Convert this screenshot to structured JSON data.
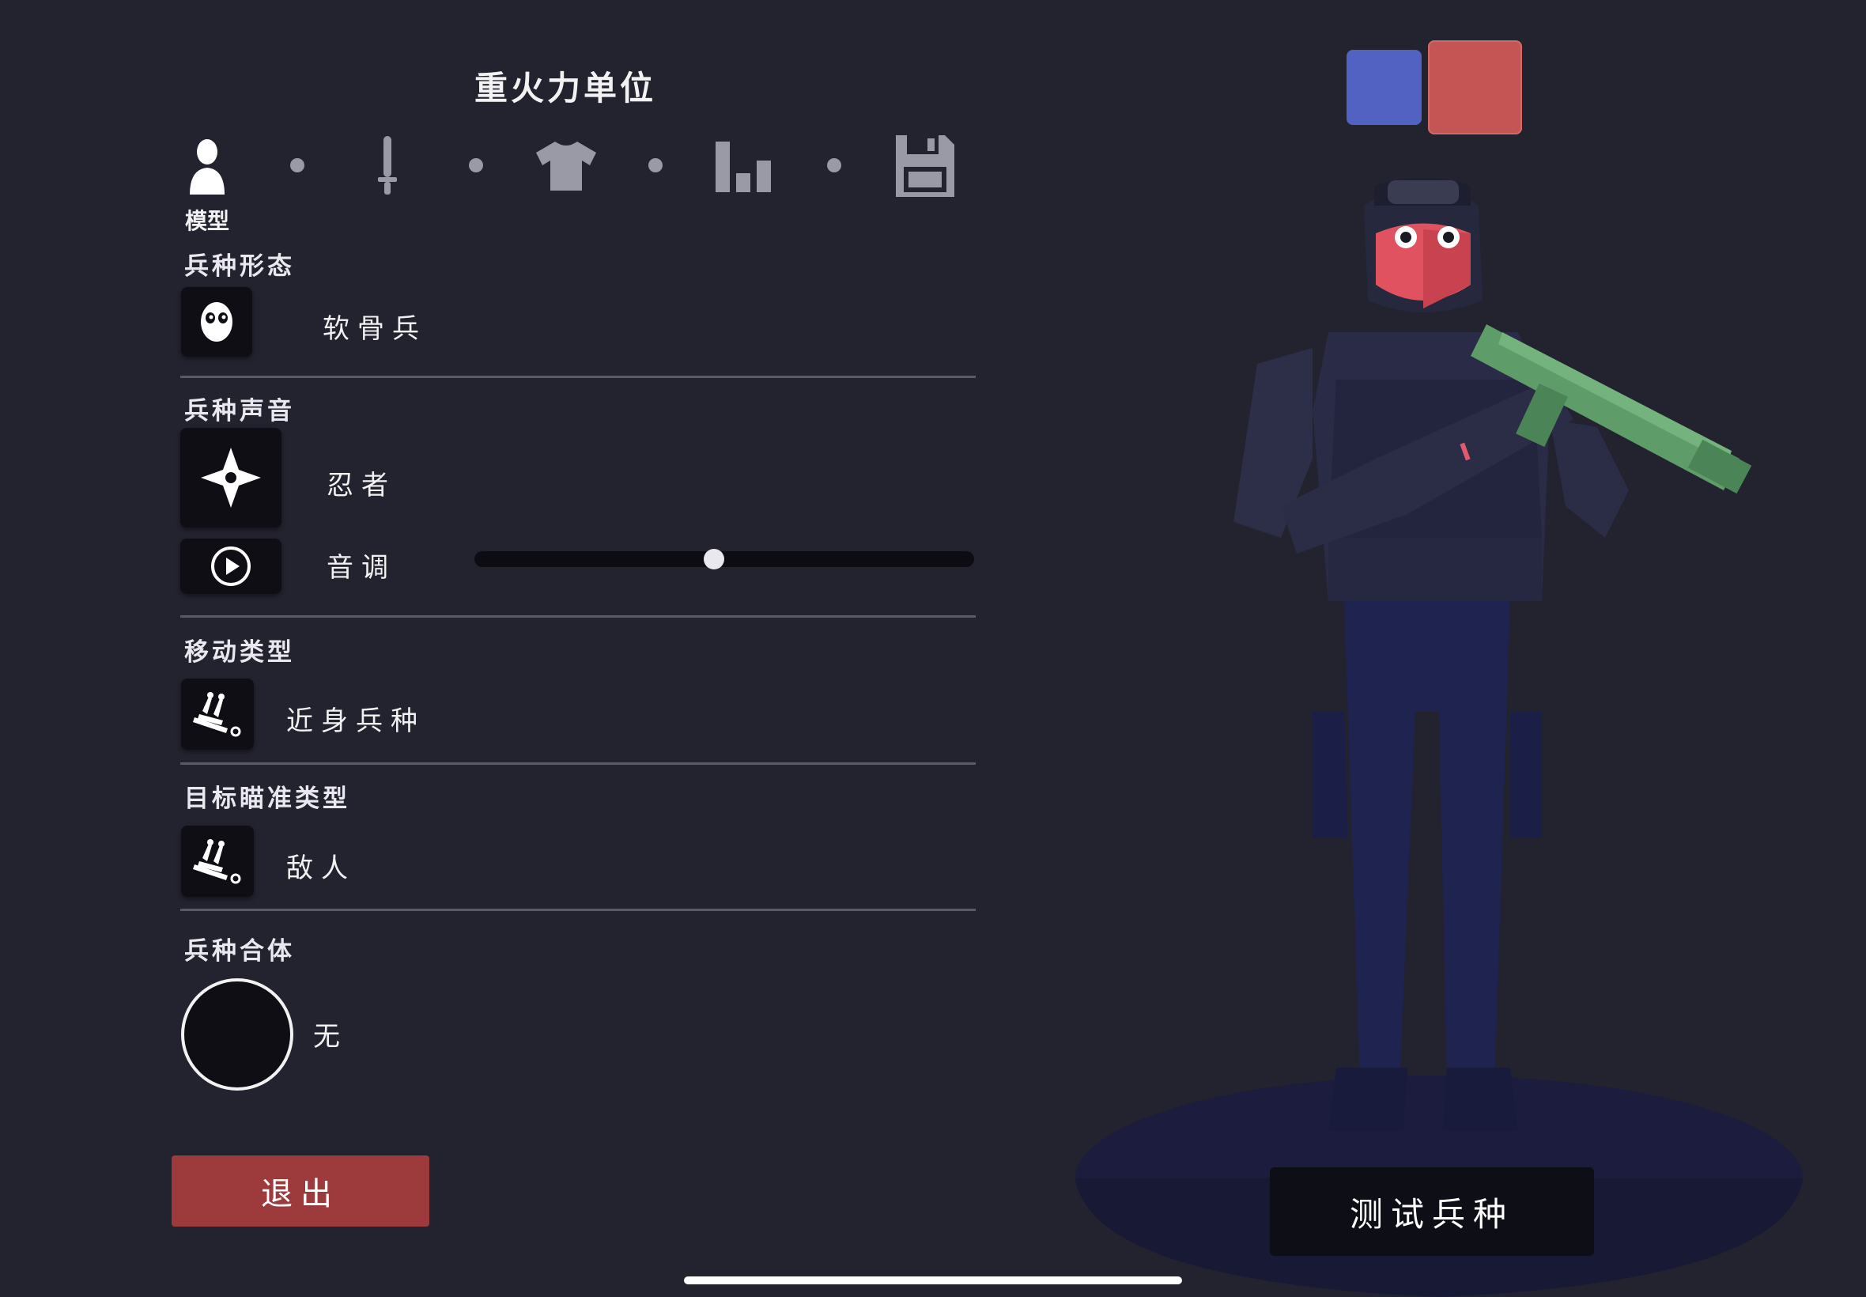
{
  "header": {
    "title": "重火力单位"
  },
  "steps": [
    {
      "name": "model",
      "icon": "person-icon",
      "label": "模型",
      "active": true
    },
    {
      "name": "weapon",
      "icon": "sword-icon",
      "active": false
    },
    {
      "name": "clothing",
      "icon": "shirt-icon",
      "active": false
    },
    {
      "name": "stats",
      "icon": "bar-chart-icon",
      "active": false
    },
    {
      "name": "save",
      "icon": "floppy-disk-icon",
      "active": false
    }
  ],
  "sections": {
    "form": {
      "title": "兵种形态",
      "value": "软骨兵",
      "icon": "wobbly-face-icon"
    },
    "voice": {
      "title": "兵种声音",
      "value": "忍者",
      "icon": "shuriken-icon",
      "pitch_label": "音调",
      "pitch_icon": "play-icon",
      "pitch_value": 0.48
    },
    "movement": {
      "title": "移动类型",
      "value": "近身兵种",
      "icon": "charge-icon"
    },
    "targeting": {
      "title": "目标瞄准类型",
      "value": "敌人",
      "icon": "charge-icon"
    },
    "merge": {
      "title": "兵种合体",
      "value": "无"
    }
  },
  "buttons": {
    "exit": "退出",
    "test": "测试兵种"
  },
  "teams": {
    "blue": "#5262c2",
    "red": "#c45554",
    "selected": "red"
  },
  "colors": {
    "background": "#23222f",
    "exit_button": "#9c3a3c",
    "weapon": "#5e9c6a"
  }
}
